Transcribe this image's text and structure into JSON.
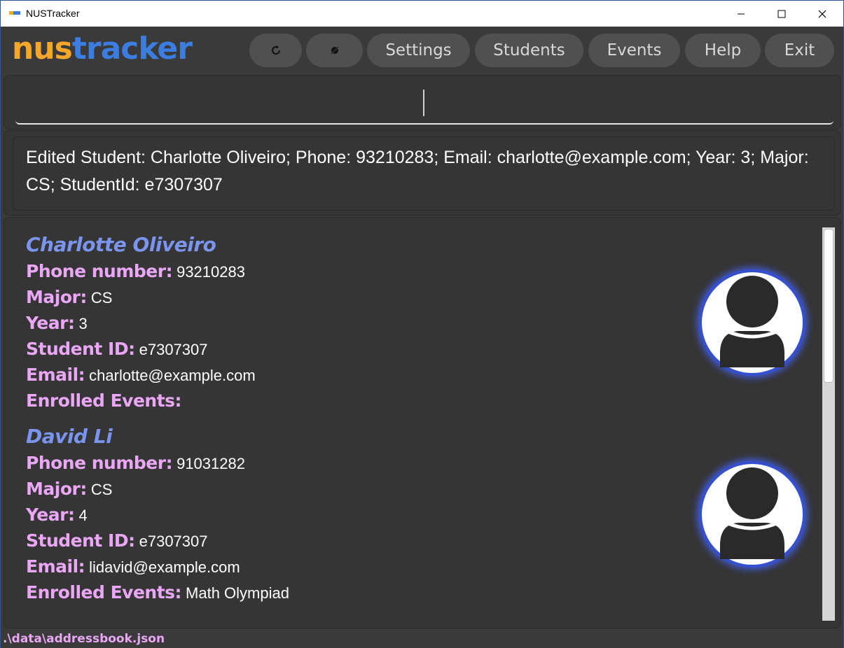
{
  "window": {
    "title": "NUSTracker"
  },
  "logo": {
    "part1": "nus",
    "part2": "tracker"
  },
  "nav": {
    "refresh_icon": "refresh-icon",
    "theme_icon": "theme-toggle-icon",
    "settings": "Settings",
    "students": "Students",
    "events": "Events",
    "help": "Help",
    "exit": "Exit"
  },
  "command": {
    "value": ""
  },
  "result": {
    "text": "Edited Student: Charlotte Oliveiro; Phone: 93210283; Email: charlotte@example.com; Year: 3; Major: CS; StudentId: e7307307"
  },
  "labels": {
    "phone": "Phone number:",
    "major": "Major:",
    "year": "Year:",
    "student_id": "Student ID:",
    "email": "Email:",
    "events": "Enrolled Events:"
  },
  "students": [
    {
      "name": "Charlotte Oliveiro",
      "phone": "93210283",
      "major": "CS",
      "year": "3",
      "student_id": "e7307307",
      "email": "charlotte@example.com",
      "events": ""
    },
    {
      "name": "David Li",
      "phone": "91031282",
      "major": "CS",
      "year": "4",
      "student_id": "e7307307",
      "email": "lidavid@example.com",
      "events": "Math Olympiad"
    }
  ],
  "status": {
    "path": ".\\data\\addressbook.json"
  },
  "colors": {
    "background": "#3a3a3a",
    "logo_nus": "#f4a72a",
    "logo_tracker": "#3b7de0",
    "name": "#7b94ee",
    "label": "#e9a7f5",
    "avatar_ring": "#3450d1"
  }
}
